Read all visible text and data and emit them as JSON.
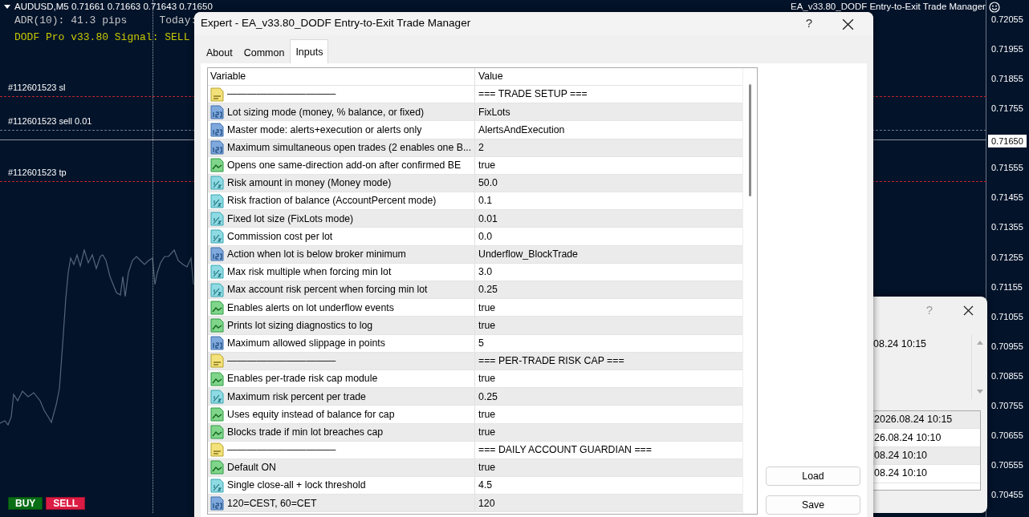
{
  "chart": {
    "symbol_line": "AUDUSD,M5  0.71661 0.71663 0.71643 0.71650",
    "expert_name": "EA_v33.80_DODF Entry-to-Exit Trade Manager",
    "adr": "ADR(10): 41.3 pips",
    "today": "Today:",
    "signal": "DODF Pro v33.80 Signal: SELL",
    "order_lines": [
      {
        "label": "#112601523 sl",
        "kind": "sl"
      },
      {
        "label": "#112601523 sell 0.01",
        "kind": "entry"
      },
      {
        "label": "#112601523 tp",
        "kind": "tp"
      }
    ],
    "price_axis_upper": [
      "0.72055",
      "0.71955",
      "0.71855",
      "0.71755"
    ],
    "price_axis_lower": [
      "0.71555",
      "0.71455",
      "0.71355",
      "0.71255",
      "0.71155",
      "0.71055",
      "0.70955",
      "0.70855",
      "0.70755",
      "0.70655",
      "0.70555",
      "0.70455"
    ],
    "current_price": "0.71650",
    "trade_buttons": [
      {
        "label": "BUY",
        "kind": "buy"
      },
      {
        "label": "SELL",
        "kind": "sell"
      }
    ]
  },
  "background_dialog": {
    "help": "?",
    "field_text": "08.24 10:15",
    "rows": [
      "2026.08.24 10:15",
      "26.08.24 10:10",
      "08.24 10:10",
      "08.24 10:10"
    ]
  },
  "dialog": {
    "title": "Expert - EA_v33.80_DODF Entry-to-Exit Trade Manager",
    "help": "?",
    "tabs": [
      {
        "label": "About",
        "selected": false
      },
      {
        "label": "Common",
        "selected": false
      },
      {
        "label": "Inputs",
        "selected": true
      }
    ],
    "columns": [
      "Variable",
      "Value"
    ],
    "rows": [
      {
        "kind": "string",
        "variable": "———————————",
        "value": "=== TRADE SETUP ==="
      },
      {
        "kind": "int",
        "variable": "Lot sizing mode (money, % balance, or fixed)",
        "value": "FixLots"
      },
      {
        "kind": "int",
        "variable": "Master mode: alerts+execution or alerts only",
        "value": "AlertsAndExecution"
      },
      {
        "kind": "int",
        "variable": "Maximum simultaneous open trades (2 enables one B...",
        "value": "2"
      },
      {
        "kind": "bool",
        "variable": "Opens one same-direction add-on after confirmed BE",
        "value": "true"
      },
      {
        "kind": "double",
        "variable": "Risk amount in money (Money mode)",
        "value": "50.0"
      },
      {
        "kind": "double",
        "variable": "Risk fraction of balance (AccountPercent mode)",
        "value": "0.1"
      },
      {
        "kind": "double",
        "variable": "Fixed lot size (FixLots mode)",
        "value": "0.01"
      },
      {
        "kind": "double",
        "variable": "Commission cost per lot",
        "value": "0.0"
      },
      {
        "kind": "int",
        "variable": "Action when lot is below broker minimum",
        "value": "Underflow_BlockTrade"
      },
      {
        "kind": "double",
        "variable": "Max risk multiple when forcing min lot",
        "value": "3.0"
      },
      {
        "kind": "double",
        "variable": "Max account risk percent when forcing min lot",
        "value": "0.25"
      },
      {
        "kind": "bool",
        "variable": "Enables alerts on lot underflow events",
        "value": "true"
      },
      {
        "kind": "bool",
        "variable": "Prints lot sizing diagnostics to log",
        "value": "true"
      },
      {
        "kind": "int",
        "variable": "Maximum allowed slippage in points",
        "value": "5"
      },
      {
        "kind": "string",
        "variable": "———————————",
        "value": "=== PER-TRADE RISK CAP ==="
      },
      {
        "kind": "bool",
        "variable": "Enables per-trade risk cap module",
        "value": "true"
      },
      {
        "kind": "double",
        "variable": "Maximum risk percent per trade",
        "value": "0.25"
      },
      {
        "kind": "bool",
        "variable": "Uses equity instead of balance for cap",
        "value": "true"
      },
      {
        "kind": "bool",
        "variable": "Blocks trade if min lot breaches cap",
        "value": "true"
      },
      {
        "kind": "string",
        "variable": "———————————",
        "value": "=== DAILY ACCOUNT GUARDIAN ==="
      },
      {
        "kind": "bool",
        "variable": "Default ON",
        "value": "true"
      },
      {
        "kind": "double",
        "variable": "Single close-all + lock threshold",
        "value": "4.5"
      },
      {
        "kind": "int",
        "variable": "120=CEST, 60=CET",
        "value": "120"
      }
    ],
    "buttons": [
      "Load",
      "Save"
    ]
  }
}
